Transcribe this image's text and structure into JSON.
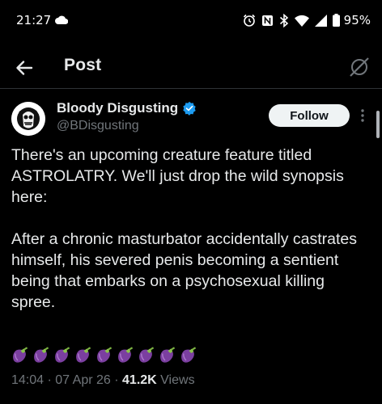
{
  "status_bar": {
    "time": "21:27",
    "battery": "95%",
    "icons": [
      "cloud-icon",
      "alarm-icon",
      "nfc-icon",
      "bluetooth-icon",
      "wifi-icon",
      "signal-icon",
      "battery-icon"
    ]
  },
  "header": {
    "title": "Post",
    "back_icon": "arrow-left-icon",
    "grok_icon": "grok-icon"
  },
  "tweet": {
    "author_name": "Bloody Disgusting",
    "author_handle": "@BDisgusting",
    "verified": true,
    "follow_label": "Follow",
    "paragraph1": "There's an upcoming creature feature titled ASTROLATRY. We'll just drop the wild synopsis here:",
    "paragraph2": "After a chronic masturbator accidentally castrates himself, his severed penis becoming a sentient being that embarks on a psychosexual killing spree.",
    "emoji": "🍆🍆🍆🍆🍆🍆🍆🍆🍆",
    "eggplant_count": 9,
    "time": "14:04",
    "date": "07 Apr 26",
    "views_count": "41.2K",
    "views_label": "Views"
  },
  "colors": {
    "background": "#000000",
    "text": "#e7e9ea",
    "secondary": "#71767b",
    "verified": "#1d9bf0",
    "eggplant": "#7b3fa0"
  }
}
